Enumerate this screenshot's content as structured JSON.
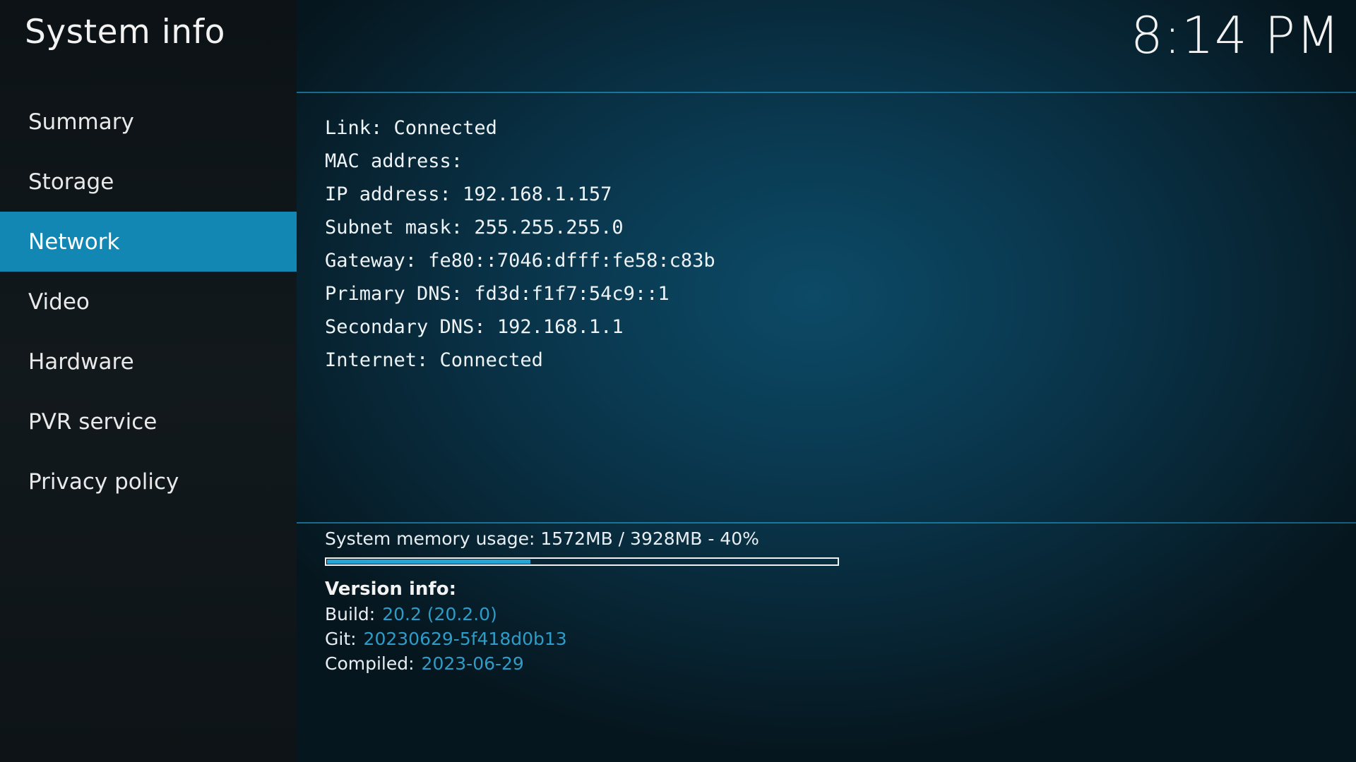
{
  "header": {
    "title": "System info",
    "clock": "8:14 PM"
  },
  "sidebar": {
    "items": [
      {
        "label": "Summary",
        "active": false
      },
      {
        "label": "Storage",
        "active": false
      },
      {
        "label": "Network",
        "active": true
      },
      {
        "label": "Video",
        "active": false
      },
      {
        "label": "Hardware",
        "active": false
      },
      {
        "label": "PVR service",
        "active": false
      },
      {
        "label": "Privacy policy",
        "active": false
      }
    ]
  },
  "network": {
    "lines": [
      "Link: Connected",
      "MAC address: ",
      "IP address: 192.168.1.157",
      "Subnet mask: 255.255.255.0",
      "Gateway: fe80::7046:dfff:fe58:c83b",
      "Primary DNS: fd3d:f1f7:54c9::1",
      "Secondary DNS: 192.168.1.1",
      "Internet: Connected"
    ]
  },
  "memory": {
    "label": "System memory usage: 1572MB / 3928MB - 40%",
    "percent": 40
  },
  "version": {
    "title": "Version info:",
    "build_label": "Build:",
    "build_value": "20.2 (20.2.0)",
    "git_label": "Git:",
    "git_value": "20230629-5f418d0b13",
    "compiled_label": "Compiled:",
    "compiled_value": "2023-06-29"
  },
  "colors": {
    "accent": "#1287b3",
    "link_value": "#2e9cc8"
  }
}
